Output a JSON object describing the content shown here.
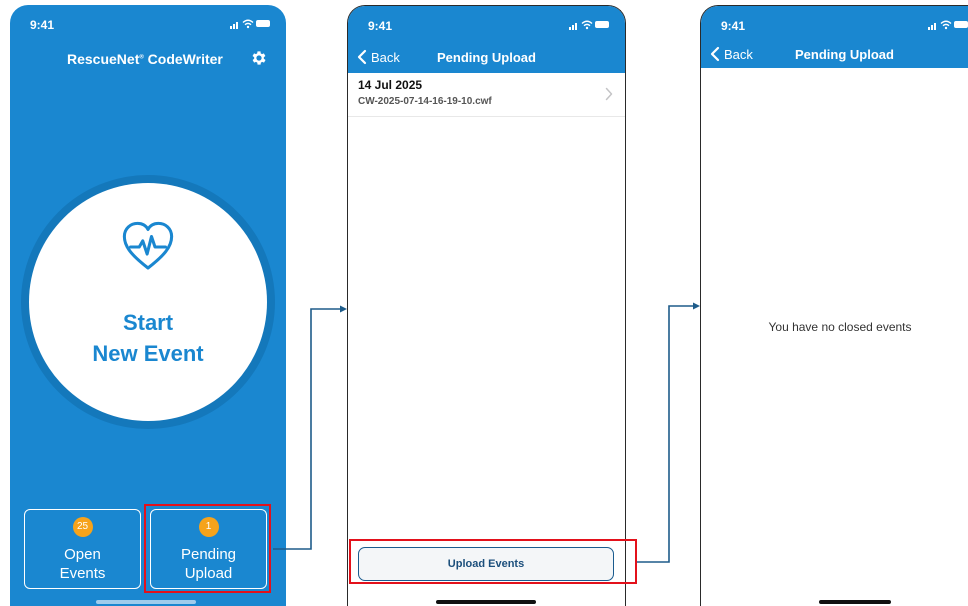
{
  "status_bar": {
    "time": "9:41"
  },
  "home": {
    "brand": "RescueNet",
    "brand_mark": "®",
    "brand_suffix": " CodeWriter",
    "start_line1": "Start",
    "start_line2": "New Event",
    "open_events": {
      "count": "25",
      "line1": "Open",
      "line2": "Events"
    },
    "pending_upload": {
      "count": "1",
      "line1": "Pending",
      "line2": "Upload"
    }
  },
  "pending_screen": {
    "back_label": "Back",
    "title": "Pending Upload",
    "items": [
      {
        "date": "14 Jul 2025",
        "file": "CW-2025-07-14-16-19-10.cwf"
      }
    ],
    "upload_button": "Upload Events"
  },
  "empty_screen": {
    "back_label": "Back",
    "title": "Pending Upload",
    "message": "You have no closed events"
  },
  "colors": {
    "brand_blue": "#1a87d0",
    "badge_orange": "#f6a31b",
    "highlight_red": "#e3111b",
    "connector_blue": "#1e5c8a"
  },
  "icons": [
    "gear-icon",
    "heart-ecg-icon",
    "back-chevron-icon",
    "chevron-right-icon",
    "signal-icon",
    "wifi-icon",
    "battery-icon"
  ]
}
